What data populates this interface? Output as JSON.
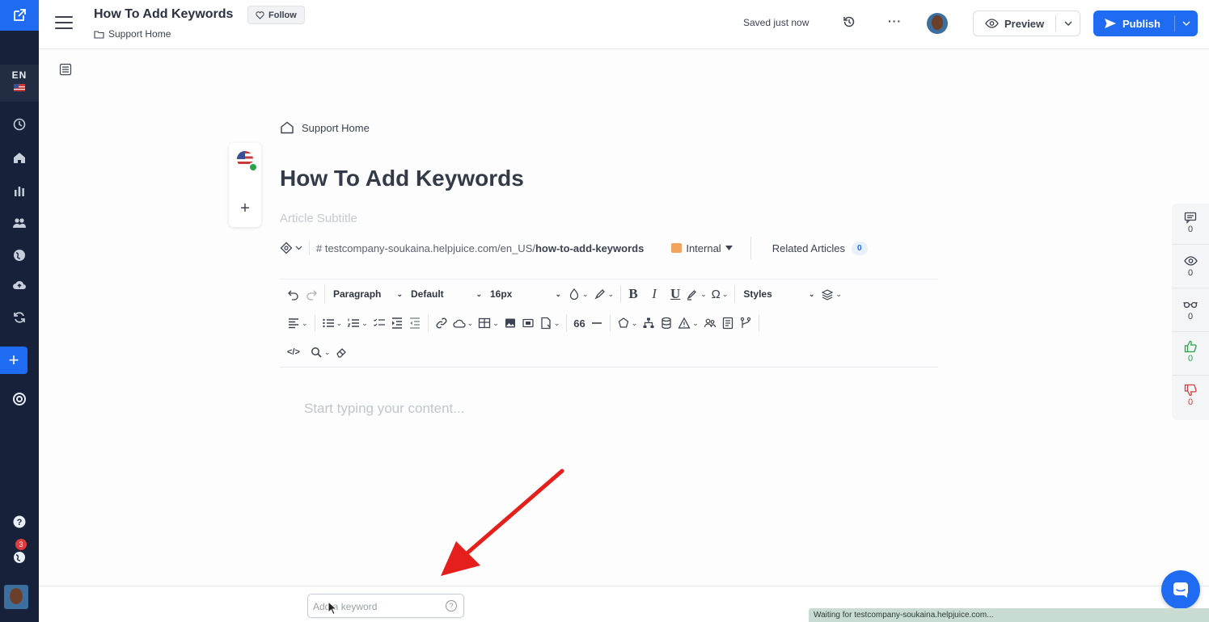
{
  "app": {
    "doc_title": "How To Add Keywords",
    "follow_label": "Follow",
    "folder_label": "Support Home",
    "saved_status": "Saved just now",
    "more_label": "···",
    "preview_label": "Preview",
    "publish_label": "Publish",
    "accent_color": "#1f6bf2"
  },
  "rail": {
    "lang_code": "EN",
    "notification_count": "3",
    "add_label": "+"
  },
  "article": {
    "breadcrumb": "Support Home",
    "title": "How To Add Keywords",
    "subtitle_placeholder": "Article Subtitle",
    "url_prefix": "# testcompany-soukaina.helpjuice.com/en_US/",
    "url_slug": "how-to-add-keywords",
    "visibility": "Internal",
    "related_label": "Related Articles",
    "related_count": "0",
    "lang_add": "+",
    "content_placeholder": "Start typing your content..."
  },
  "toolbar": {
    "paragraph": "Paragraph",
    "font": "Default",
    "size": "16px",
    "styles": "Styles",
    "bold": "B",
    "italic": "I",
    "underline": "U",
    "omega": "Ω"
  },
  "stats": {
    "comments": "0",
    "views": "0",
    "readers": "0",
    "likes": "0",
    "dislikes": "0"
  },
  "bottom": {
    "keyword_placeholder": "Add a keyword",
    "status_text": "Waiting for testcompany-soukaina.helpjuice.com..."
  }
}
